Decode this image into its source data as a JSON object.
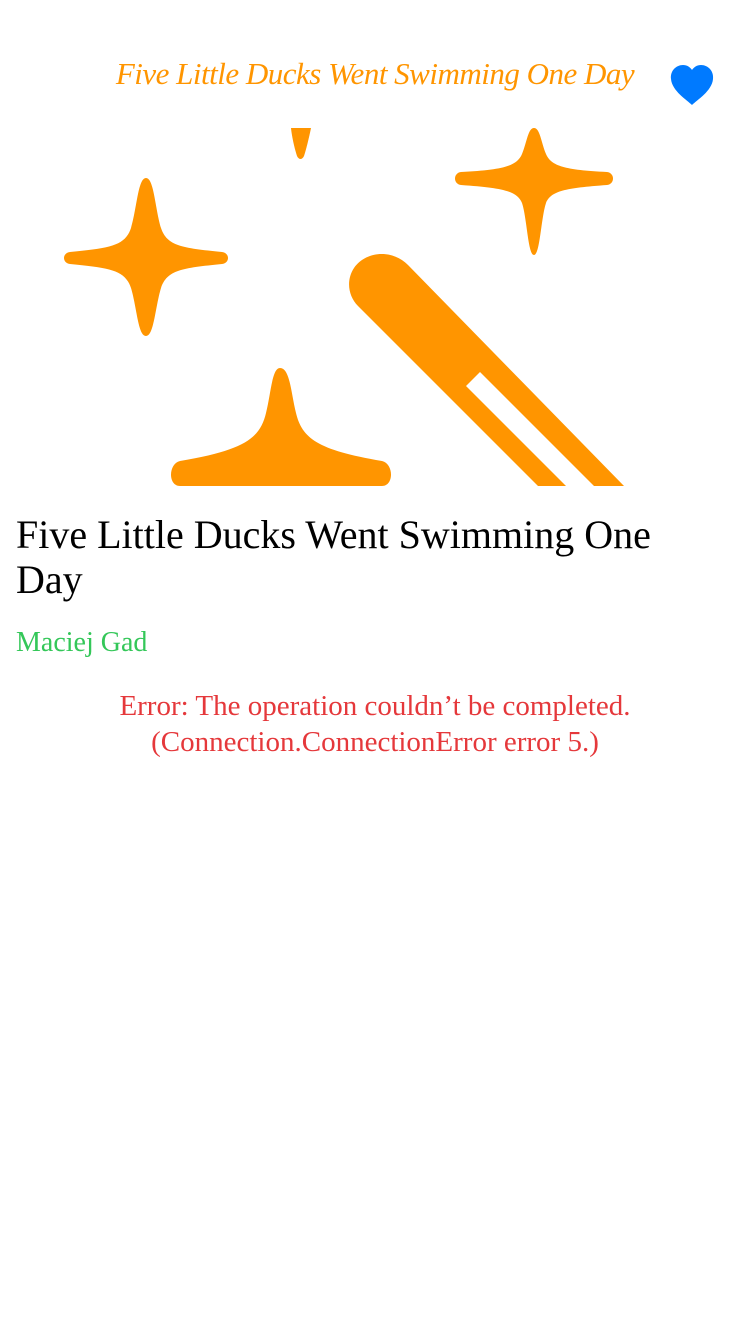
{
  "nav": {
    "title": "Five Little Ducks Went Swimming One Day",
    "favorite_icon": "heart-fill-icon",
    "favorite_color": "#007AFF"
  },
  "hero": {
    "icon": "wand-and-sparkles-icon",
    "color": "#FF9500"
  },
  "book": {
    "title": "Five Little Ducks Went Swimming One Day",
    "author": "Maciej Gad",
    "title_color": "#000000",
    "author_color": "#34C759"
  },
  "error": {
    "line1": "Error: The operation couldn’t be completed.",
    "line2": "(Connection.ConnectionError error 5.)",
    "color": "#E5383B"
  }
}
